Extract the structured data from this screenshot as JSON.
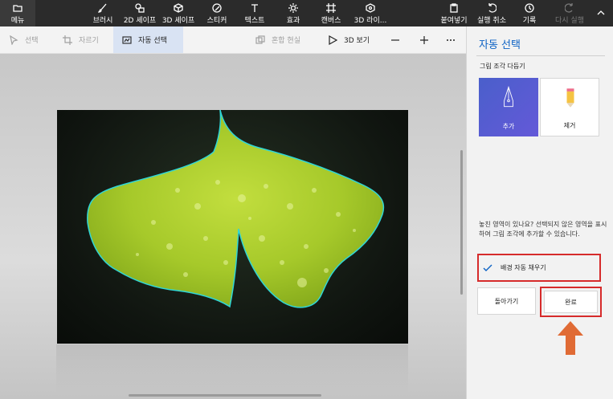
{
  "toolbar": {
    "menu": "메뉴",
    "brush": "브러시",
    "shapes2d": "2D 셰이프",
    "shapes3d": "3D 셰이프",
    "stickers": "스티커",
    "text": "텍스트",
    "effects": "효과",
    "canvas": "캔버스",
    "library3d": "3D 라이...",
    "paste": "붙여넣기",
    "undo": "실행 취소",
    "history": "기록",
    "redo": "다시 실행"
  },
  "secondary": {
    "select": "선택",
    "crop": "자르기",
    "magic_select": "자동 선택",
    "mixed_reality": "혼합 현실",
    "view3d": "3D 보기"
  },
  "panel": {
    "title": "자동 선택",
    "subtitle": "그림 조각 다듬기",
    "add": "추가",
    "remove": "제거",
    "hint": "놓친 영역이 있나요? 선택되지 않은 영역을 표시하여 그림 조각에 추가할 수 있습니다.",
    "autofill": "배경 자동 채우기",
    "back": "돌아가기",
    "done": "완료"
  },
  "colors": {
    "accent": "#0b61c4",
    "highlight": "#d62b2b",
    "arrow": "#e06b35",
    "leaf": "#a8cc2a"
  }
}
